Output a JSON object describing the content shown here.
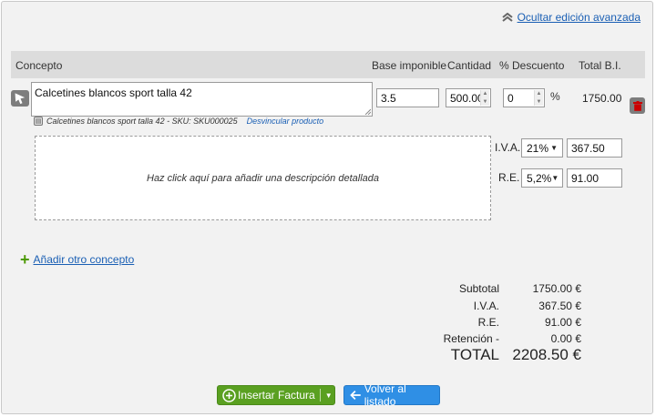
{
  "top": {
    "advanced_link": "Ocultar edición avanzada",
    "advanced_icon": "double-chevron-up-icon"
  },
  "table": {
    "headers": {
      "concept": "Concepto",
      "base": "Base imponible",
      "qty": "Cantidad",
      "discount": "% Descuento",
      "total": "Total B.I."
    }
  },
  "line": {
    "concept": "Calcetines blancos sport talla 42",
    "sku_text": "Calcetines blancos sport talla 42 - SKU: SKU000025",
    "unlink": "Desvincular producto",
    "base": "3.5",
    "qty": "500.00",
    "discount": "0",
    "pct_sign": "%",
    "total": "1750.00",
    "description_placeholder": "Haz click aquí para añadir una descripción detallada"
  },
  "taxes": {
    "iva_label": "I.V.A.",
    "iva_rate": "21%",
    "iva_amount": "367.50",
    "re_label": "R.E.",
    "re_rate": "5,2%",
    "re_amount": "91.00"
  },
  "add_concept": "Añadir otro concepto",
  "summary": {
    "subtotal_label": "Subtotal",
    "subtotal": "1750.00 €",
    "iva_label": "I.V.A.",
    "iva": "367.50 €",
    "re_label": "R.E.",
    "re": "91.00 €",
    "retention_label": "Retención -",
    "retention": "0.00 €",
    "total_label": "TOTAL",
    "total": "2208.50 €"
  },
  "buttons": {
    "insert": "Insertar Factura",
    "back": "Volver al listado"
  },
  "colors": {
    "link": "#1a5fb4",
    "green": "#5aa021",
    "blue": "#2f8fe5",
    "header_bg": "#dcdcdc"
  }
}
